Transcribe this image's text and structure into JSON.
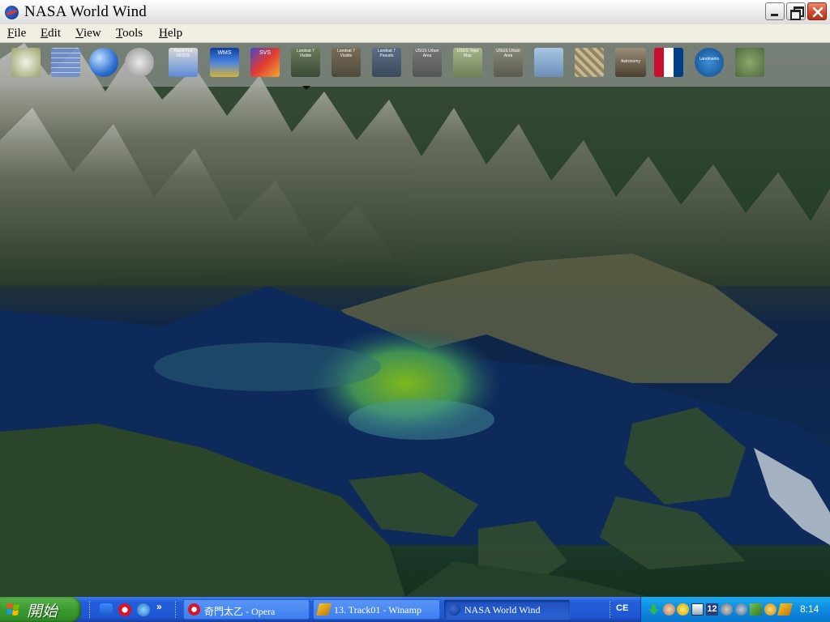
{
  "window": {
    "title": "NASA World Wind",
    "controls": [
      "minimize",
      "maximize",
      "close"
    ]
  },
  "menu": {
    "items": [
      {
        "accel": "F",
        "rest": "ile"
      },
      {
        "accel": "E",
        "rest": "dit"
      },
      {
        "accel": "V",
        "rest": "iew"
      },
      {
        "accel": "T",
        "rest": "ools"
      },
      {
        "accel": "H",
        "rest": "elp"
      }
    ]
  },
  "toolbar": {
    "buttons": [
      {
        "name": "star-compass",
        "label": ""
      },
      {
        "name": "lat-lon-grid",
        "label": ""
      },
      {
        "name": "globe",
        "label": ""
      },
      {
        "name": "place-finder",
        "label": ""
      },
      {
        "name": "rapid-fire-modis",
        "label": "Rapid Fire MODIS"
      },
      {
        "name": "wms-browser",
        "label": "WMS"
      },
      {
        "name": "scientific-visualization",
        "label": "SVS"
      },
      {
        "name": "landsat7-visible",
        "label": "Landsat 7 Visible"
      },
      {
        "name": "landsat7-visible-2",
        "label": "Landsat 7 Visible"
      },
      {
        "name": "landsat7-pseudo",
        "label": "Landsat 7 Pseudo"
      },
      {
        "name": "usgs-urban-area",
        "label": "USGS Urban Area"
      },
      {
        "name": "usgs-topo-map",
        "label": "USGS Topo Map"
      },
      {
        "name": "usgs-urban-area-2",
        "label": "USGS Urban Area"
      },
      {
        "name": "usgs-imagery",
        "label": ""
      },
      {
        "name": "usgs-grid",
        "label": ""
      },
      {
        "name": "astronomy",
        "label": "Astronomy"
      },
      {
        "name": "country-flags",
        "label": ""
      },
      {
        "name": "landmarks",
        "label": "Landmarks"
      },
      {
        "name": "boundaries",
        "label": ""
      }
    ]
  },
  "taskbar": {
    "start_label": "開始",
    "tasks": [
      {
        "name": "opera",
        "label": "奇門太乙 - Opera"
      },
      {
        "name": "winamp",
        "label": "13. Track01 - Winamp"
      },
      {
        "name": "world-wind",
        "label": "NASA World Wind"
      }
    ],
    "language": "CE",
    "clock": "8:14"
  },
  "colors": {
    "taskbar_blue": "#245edb",
    "start_green": "#3a9a2f",
    "tray_blue": "#0f8ae0",
    "close_red": "#d04427"
  }
}
